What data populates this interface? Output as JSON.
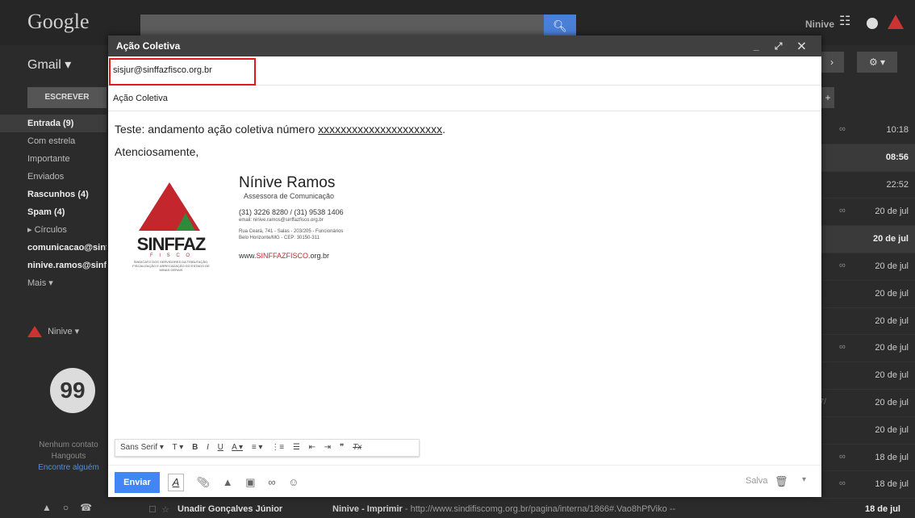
{
  "header": {
    "logo": "Google",
    "user_name": "Ninive"
  },
  "nav": {
    "app_label": "Gmail ▾",
    "compose": "ESCREVER",
    "items": [
      {
        "label": "Entrada (9)",
        "bold": true
      },
      {
        "label": "Com estrela",
        "bold": false
      },
      {
        "label": "Importante",
        "bold": false
      },
      {
        "label": "Enviados",
        "bold": false
      },
      {
        "label": "Rascunhos (4)",
        "bold": true
      },
      {
        "label": "Spam (4)",
        "bold": true
      },
      {
        "label": "▸ Círculos",
        "bold": false
      },
      {
        "label": "comunicacao@sinf",
        "bold": true
      },
      {
        "label": "ninive.ramos@sinff",
        "bold": true
      },
      {
        "label": "Mais ▾",
        "bold": false
      }
    ],
    "user_label": "Ninive ▾",
    "hangouts_icon": "99",
    "no_contacts": "Nenhum contato",
    "hangouts": "Hangouts",
    "find_link": "Encontre alguém"
  },
  "list": {
    "rows": [
      {
        "frag": "",
        "date": "10:18",
        "bold": false,
        "clip": true
      },
      {
        "frag": "l l",
        "date": "08:56",
        "bold": true,
        "clip": false
      },
      {
        "frag": "ol",
        "date": "22:52",
        "bold": false,
        "clip": false
      },
      {
        "frag": "",
        "date": "20 de jul",
        "bold": false,
        "clip": true
      },
      {
        "frag": "o",
        "date": "20 de jul",
        "bold": true,
        "clip": false
      },
      {
        "frag": "",
        "date": "20 de jul",
        "bold": false,
        "clip": true
      },
      {
        "frag": "ta",
        "date": "20 de jul",
        "bold": false,
        "clip": false
      },
      {
        "frag": "o",
        "date": "20 de jul",
        "bold": false,
        "clip": false
      },
      {
        "frag": "a",
        "date": "20 de jul",
        "bold": false,
        "clip": true
      },
      {
        "frag": "tri",
        "date": "20 de jul",
        "bold": false,
        "clip": false
      },
      {
        "frag": "07/",
        "date": "20 de jul",
        "bold": false,
        "clip": false
      },
      {
        "frag": "s",
        "date": "20 de jul",
        "bold": false,
        "clip": false
      },
      {
        "frag": "",
        "date": "18 de jul",
        "bold": false,
        "clip": true
      },
      {
        "frag": "",
        "date": "18 de jul",
        "bold": false,
        "clip": true
      }
    ],
    "bottom": {
      "sender": "Unadir Gonçalves Júnior",
      "subject_bold": "Ninive - Imprimir",
      "snippet": " - http://www.sindifiscomg.org.br/pagina/interna/1866#.Vao8hPfViko --",
      "date": "18 de jul"
    }
  },
  "compose": {
    "title": "Ação Coletiva",
    "controls": "_ ⤢ ✕",
    "to": "sisjur@sinffazfisco.org.br",
    "subject": "Ação Coletiva",
    "body_line1_prefix": "Teste: andamento",
    "body_line1_mid": " ação coletiva número ",
    "body_line1_underlined": "xxxxxxxxxxxxxxxxxxxxxx",
    "body_line1_suffix": ".",
    "body_line2": "Atenciosamente,",
    "signature": {
      "name": "Nínive Ramos",
      "role": "Assessora de Comunicação",
      "phone": "(31) 3226 8280 / (31) 9538 1406",
      "email": "email: ninive.ramos@sinffazfisco.org.br",
      "address": "Rua Ceará, 741 - Salas - 203/205 - Funcionários",
      "city": "Belo Horizonte/MG - CEP: 30150-311",
      "web_prefix": "www.",
      "web_accent": "SINFFAZFISCO",
      "web_suffix": ".org.br",
      "logo_word": "SINFFAZ",
      "logo_sub": "F I S C O",
      "logo_small": "SINDICATO DOS SERVIDORES DA TRIBUTAÇÃO, FISCALIZAÇÃO E ARRECADAÇÃO DO ESTADO DE MINAS GERAIS"
    },
    "format_bar": {
      "font": "Sans Serif ▾",
      "size": "T ▾",
      "bold": "B",
      "italic": "I",
      "underline": "U",
      "text_color": "A ▾",
      "align": "≡ ▾",
      "numbered": "⋮≡",
      "bulleted": "☰",
      "indent_less": "⇤",
      "indent_more": "⇥",
      "quote": "❞",
      "clear": "Tx"
    },
    "send": "Enviar",
    "saved": "Salva"
  }
}
